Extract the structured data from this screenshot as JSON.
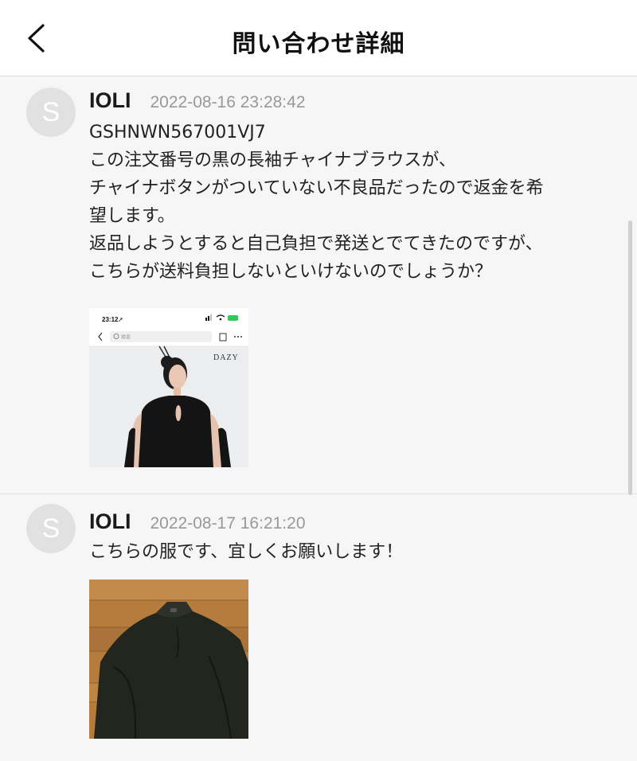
{
  "header": {
    "title": "問い合わせ詳細"
  },
  "messages": [
    {
      "avatar_letter": "S",
      "username": "IOLI",
      "timestamp": "2022-08-16 23:28:42",
      "lines": [
        "GSHNWN567001VJ7",
        "この注文番号の黒の長袖チャイナブラウスが、",
        "チャイナボタンがついていない不良品だったので返金を希",
        "望します。",
        "返品しようとすると自己負担で発送とでてきたのですが、",
        "こちらが送料負担しないといけないのでしょうか？"
      ],
      "attachment": {
        "status_time": "23:12",
        "search_placeholder": "検索",
        "brand": "DAZY"
      }
    },
    {
      "avatar_letter": "S",
      "username": "IOLI",
      "timestamp": "2022-08-17 16:21:20",
      "lines": [
        "こちらの服です、宜しくお願いします！"
      ]
    }
  ],
  "colors": {
    "header_bg": "#ffffff",
    "page_bg": "#f6f6f6",
    "avatar_bg": "#e1e1e1",
    "timestamp": "#999999"
  },
  "icons": [
    "back-chevron-icon",
    "search-icon",
    "bag-icon",
    "more-icon"
  ]
}
